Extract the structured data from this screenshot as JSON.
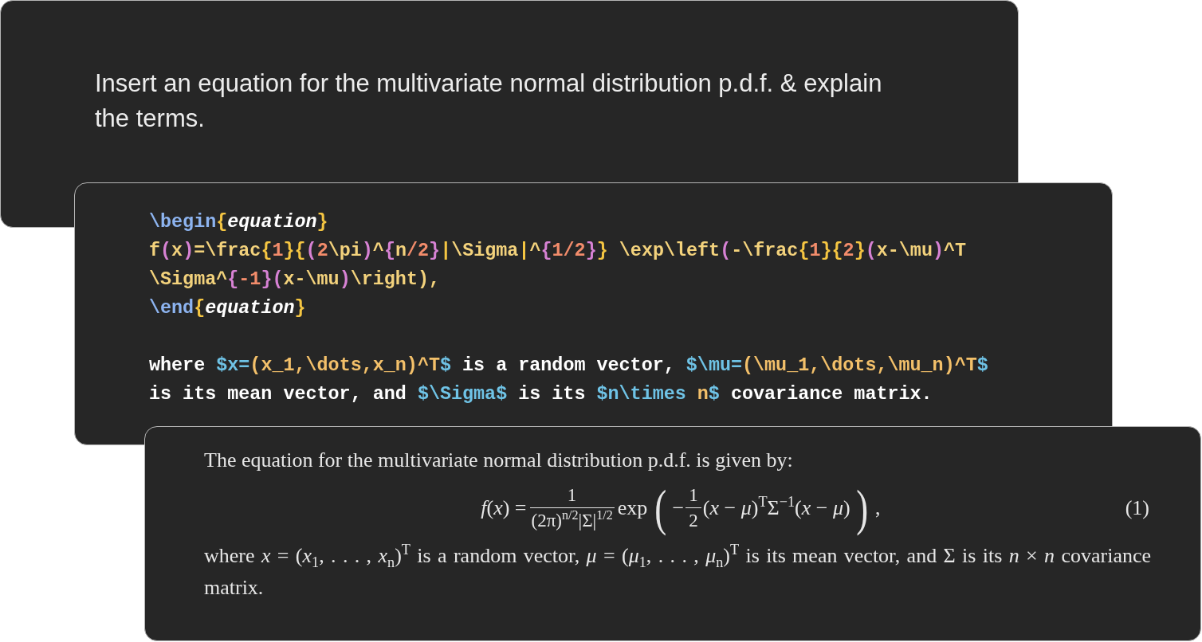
{
  "prompt_card": {
    "text": "Insert an equation for the multivariate normal distribution p.d.f. & explain the terms."
  },
  "code_card": {
    "blocks": [
      [
        [
          {
            "kind": "cmd",
            "text": "\\begin"
          },
          {
            "kind": "brace",
            "text": "{"
          },
          {
            "kind": "emph",
            "text": "equation"
          },
          {
            "kind": "brace",
            "text": "}"
          }
        ],
        [
          {
            "kind": "text",
            "text": "f"
          },
          {
            "kind": "paren",
            "text": "("
          },
          {
            "kind": "text",
            "text": "x"
          },
          {
            "kind": "paren",
            "text": ")"
          },
          {
            "kind": "text",
            "text": "=\\frac"
          },
          {
            "kind": "brace",
            "text": "{"
          },
          {
            "kind": "num",
            "text": "1"
          },
          {
            "kind": "brace",
            "text": "}{"
          },
          {
            "kind": "paren",
            "text": "("
          },
          {
            "kind": "num",
            "text": "2"
          },
          {
            "kind": "text",
            "text": "\\pi"
          },
          {
            "kind": "paren",
            "text": ")"
          },
          {
            "kind": "text",
            "text": "^"
          },
          {
            "kind": "paren",
            "text": "{"
          },
          {
            "kind": "text",
            "text": "n"
          },
          {
            "kind": "num",
            "text": "/2"
          },
          {
            "kind": "paren",
            "text": "}"
          },
          {
            "kind": "brace",
            "text": "|"
          },
          {
            "kind": "text",
            "text": "\\Sigma"
          },
          {
            "kind": "brace",
            "text": "|"
          },
          {
            "kind": "text",
            "text": "^"
          },
          {
            "kind": "paren",
            "text": "{"
          },
          {
            "kind": "num",
            "text": "1/2"
          },
          {
            "kind": "paren",
            "text": "}"
          },
          {
            "kind": "brace",
            "text": "}"
          },
          {
            "kind": "text",
            "text": " \\exp\\left"
          },
          {
            "kind": "paren",
            "text": "("
          },
          {
            "kind": "text",
            "text": "-\\frac"
          },
          {
            "kind": "brace",
            "text": "{"
          },
          {
            "kind": "num",
            "text": "1"
          },
          {
            "kind": "brace",
            "text": "}{"
          },
          {
            "kind": "num",
            "text": "2"
          },
          {
            "kind": "brace",
            "text": "}"
          },
          {
            "kind": "paren",
            "text": "("
          },
          {
            "kind": "text",
            "text": "x-\\mu"
          },
          {
            "kind": "paren",
            "text": ")"
          },
          {
            "kind": "text",
            "text": "^T"
          }
        ],
        [
          {
            "kind": "text",
            "text": "\\Sigma^"
          },
          {
            "kind": "paren",
            "text": "{"
          },
          {
            "kind": "num",
            "text": "-1"
          },
          {
            "kind": "paren",
            "text": "}("
          },
          {
            "kind": "text",
            "text": "x-\\mu"
          },
          {
            "kind": "paren",
            "text": ")"
          },
          {
            "kind": "text",
            "text": "\\right),"
          }
        ],
        [
          {
            "kind": "cmd",
            "text": "\\end"
          },
          {
            "kind": "brace",
            "text": "{"
          },
          {
            "kind": "emph",
            "text": "equation"
          },
          {
            "kind": "brace",
            "text": "}"
          }
        ]
      ],
      [
        [
          {
            "kind": "plain",
            "text": "where "
          },
          {
            "kind": "math",
            "text": "$x="
          },
          {
            "kind": "marg",
            "text": "(x_1,\\dots,x_n)^T"
          },
          {
            "kind": "math",
            "text": "$"
          },
          {
            "kind": "plain",
            "text": " is a random vector, "
          },
          {
            "kind": "math",
            "text": "$\\mu="
          },
          {
            "kind": "marg",
            "text": "(\\mu_1,\\dots,\\mu_n)^T"
          },
          {
            "kind": "math",
            "text": "$"
          }
        ],
        [
          {
            "kind": "plain",
            "text": "is its mean vector, and "
          },
          {
            "kind": "math",
            "text": "$\\Sigma$"
          },
          {
            "kind": "plain",
            "text": " is its "
          },
          {
            "kind": "math",
            "text": "$n\\times"
          },
          {
            "kind": "marg",
            "text": " n"
          },
          {
            "kind": "math",
            "text": "$"
          },
          {
            "kind": "plain",
            "text": " covariance matrix."
          }
        ]
      ]
    ]
  },
  "rendered_card": {
    "intro": "The equation for the multivariate normal distribution p.d.f. is given by:",
    "equation": {
      "lhs": "*f*(*x*) =",
      "fraction": {
        "numerator": "1",
        "denominator": "(2π)$^{n/2}$|Σ|$^{1/2}$"
      },
      "function": "exp",
      "open": "(",
      "sign": "−",
      "inner_fraction": {
        "numerator": "1",
        "denominator": "2"
      },
      "rest": "(*x* − *μ*)$^{T}$Σ$^{−1}$(*x* − *μ*)",
      "close": ")",
      "trailing": ",",
      "number": "(1)"
    },
    "explanation": "where *x* = (*x*$_{1}$, . . . , *x*$_{n}$)$^{T}$ is a random vector, *μ* = (*μ*$_{1}$, . . . , *μ*$_{n}$)$^{T}$ is its mean vector, and Σ is its *n* × *n* covariance matrix."
  }
}
